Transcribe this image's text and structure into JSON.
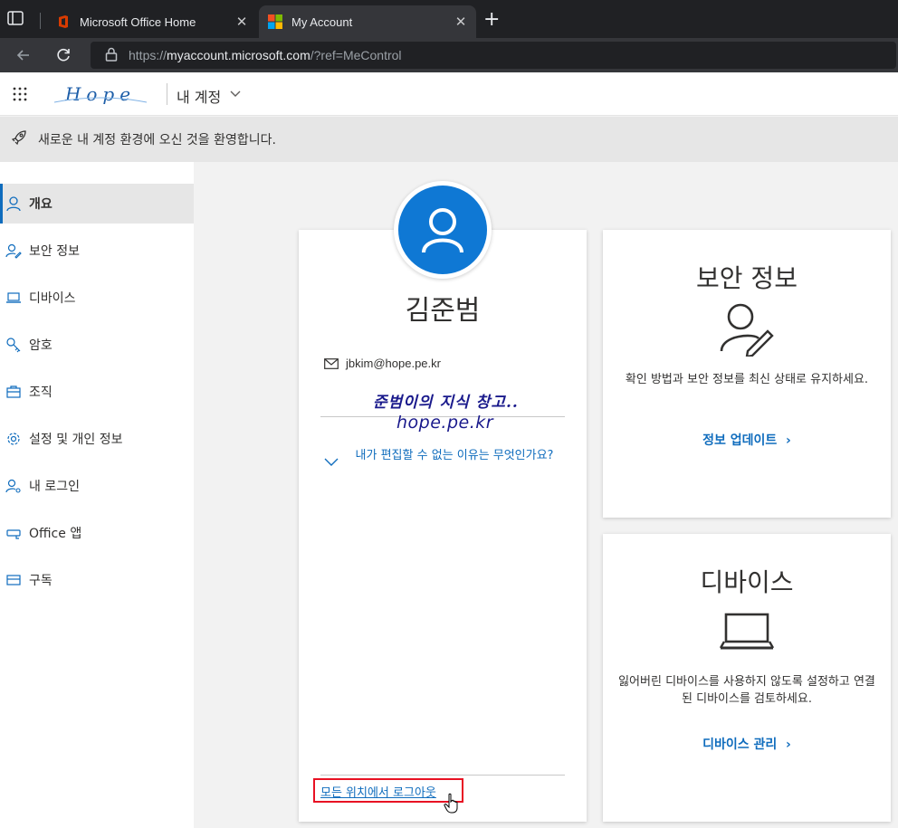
{
  "browser": {
    "tabs": [
      {
        "title": "Microsoft Office Home",
        "active": false,
        "icon": "office-icon"
      },
      {
        "title": "My Account",
        "active": true,
        "icon": "microsoft-logo-icon"
      }
    ],
    "url": {
      "prefix": "https://",
      "host": "myaccount.microsoft.com",
      "path": "/?ref=MeControl"
    }
  },
  "header": {
    "brand": "Hope",
    "title": "내 계정"
  },
  "banner": {
    "text": "새로운 내 계정 환경에 오신 것을 환영합니다."
  },
  "sidebar": {
    "items": [
      {
        "label": "개요",
        "icon": "person-icon",
        "active": true
      },
      {
        "label": "보안 정보",
        "icon": "person-key-icon",
        "active": false
      },
      {
        "label": "디바이스",
        "icon": "laptop-icon",
        "active": false
      },
      {
        "label": "암호",
        "icon": "key-icon",
        "active": false
      },
      {
        "label": "조직",
        "icon": "briefcase-icon",
        "active": false
      },
      {
        "label": "설정 및 개인 정보",
        "icon": "gear-icon",
        "active": false
      },
      {
        "label": "내 로그인",
        "icon": "person-key-icon",
        "active": false
      },
      {
        "label": "Office 앱",
        "icon": "office-apps-icon",
        "active": false
      },
      {
        "label": "구독",
        "icon": "subscription-icon",
        "active": false
      }
    ]
  },
  "profile": {
    "name": "김준범",
    "email": "jbkim@hope.pe.kr",
    "watermark_line1": "준범이의 지식 창고..",
    "watermark_line2": "hope.pe.kr",
    "why_cant_edit": "내가 편집할 수 없는 이유는 무엇인가요?",
    "signout_everywhere": "모든 위치에서 로그아웃"
  },
  "security_card": {
    "title": "보안 정보",
    "description": "확인 방법과 보안 정보를 최신 상태로 유지하세요.",
    "link": "정보 업데이트"
  },
  "devices_card": {
    "title": "디바이스",
    "description": "잃어버린 디바이스를 사용하지 않도록 설정하고 연결된 디바이스를 검토하세요.",
    "link": "디바이스 관리"
  },
  "colors": {
    "accent": "#0f6cbd",
    "avatar": "#0f78d4",
    "highlight_box": "#e81123"
  }
}
